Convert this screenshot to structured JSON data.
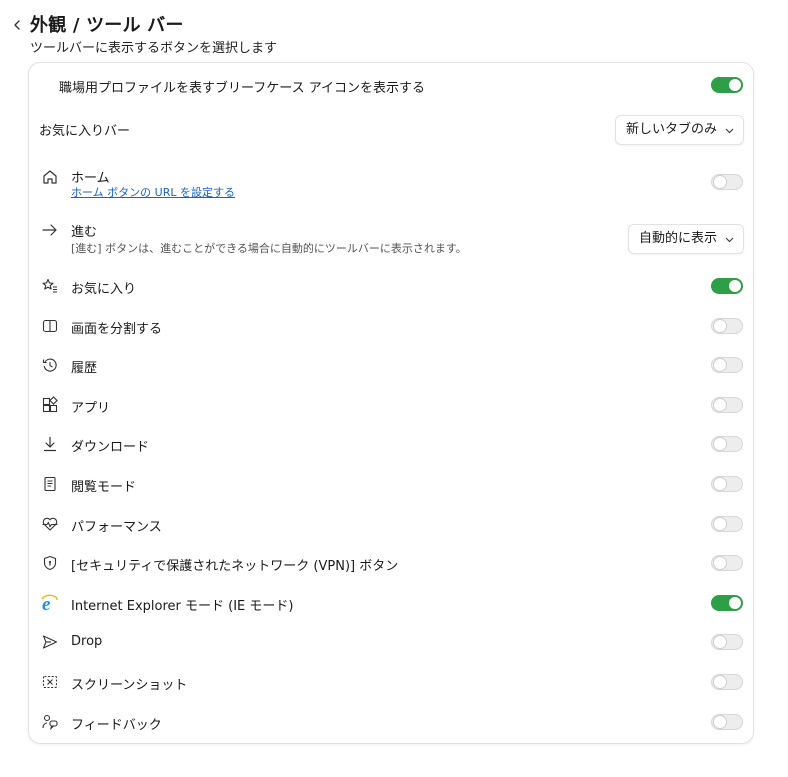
{
  "header": {
    "title": "外観 / ツール バー",
    "subtitle": "ツールバーに表示するボタンを選択します"
  },
  "colors": {
    "toggle_on": "#2e9e47",
    "link": "#1a62c6"
  },
  "settings": {
    "work_profile": {
      "label": "職場用プロファイルを表すブリーフケース アイコンを表示する",
      "enabled": true
    },
    "favorites_bar": {
      "label": "お気に入りバー",
      "value": "新しいタブのみ"
    },
    "home": {
      "label": "ホーム",
      "link": "ホーム ボタンの URL を設定する",
      "enabled": false,
      "icon": "home-icon"
    },
    "forward": {
      "label": "進む",
      "description": "[進む] ボタンは、進むことができる場合に自動的にツールバーに表示されます。",
      "value": "自動的に表示",
      "icon": "arrow-right-icon"
    },
    "items": [
      {
        "key": "favorites",
        "label": "お気に入り",
        "enabled": true,
        "icon": "star-list-icon"
      },
      {
        "key": "split-screen",
        "label": "画面を分割する",
        "enabled": false,
        "icon": "split-screen-icon"
      },
      {
        "key": "history",
        "label": "履歴",
        "enabled": false,
        "icon": "history-icon"
      },
      {
        "key": "apps",
        "label": "アプリ",
        "enabled": false,
        "icon": "apps-icon"
      },
      {
        "key": "downloads",
        "label": "ダウンロード",
        "enabled": false,
        "icon": "download-icon"
      },
      {
        "key": "reading-mode",
        "label": "閲覧モード",
        "enabled": false,
        "icon": "reading-mode-icon"
      },
      {
        "key": "performance",
        "label": "パフォーマンス",
        "enabled": false,
        "icon": "heartbeat-icon"
      },
      {
        "key": "vpn",
        "label": "[セキュリティで保護されたネットワーク (VPN)] ボタン",
        "enabled": false,
        "icon": "shield-icon"
      },
      {
        "key": "ie-mode",
        "label": "Internet Explorer モード (IE モード)",
        "enabled": true,
        "icon": "internet-explorer-icon"
      },
      {
        "key": "drop",
        "label": "Drop",
        "enabled": false,
        "icon": "send-icon"
      },
      {
        "key": "screenshot",
        "label": "スクリーンショット",
        "enabled": false,
        "icon": "screenshot-icon"
      },
      {
        "key": "feedback",
        "label": "フィードバック",
        "enabled": false,
        "icon": "feedback-icon"
      }
    ]
  }
}
